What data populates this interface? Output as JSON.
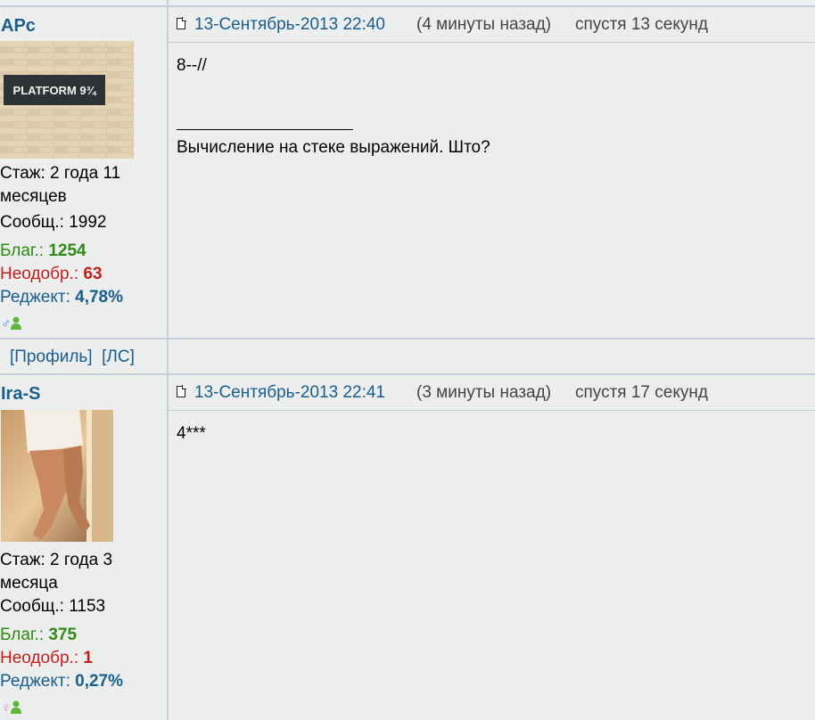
{
  "posts": [
    {
      "author": "APc",
      "avatar_text": "PLATFORM 9¾",
      "tenure": "Стаж: 2 года 11 месяцев",
      "messages_label": "Сообщ.:",
      "messages_value": "1992",
      "thanks_label": "Благ.:",
      "thanks_value": "1254",
      "disapprove_label": "Неодобр.:",
      "disapprove_value": "63",
      "reject_label": "Реджект:",
      "reject_value": "4,78%",
      "gender_icon": "male-icon",
      "date": "13-Сентябрь-2013 22:40",
      "ago": "(4 минуты назад)",
      "after": "спустя 13 секунд",
      "body_line1": "8--//",
      "signature": "Вычисление на стеке выражений. Што?",
      "profile_link": "[Профиль]",
      "pm_link": "[ЛС]"
    },
    {
      "author": "Ira-S",
      "tenure": "Стаж: 2 года 3 месяца",
      "messages_label": "Сообщ.:",
      "messages_value": "1153",
      "thanks_label": "Благ.:",
      "thanks_value": "375",
      "disapprove_label": "Неодобр.:",
      "disapprove_value": "1",
      "reject_label": "Реджект:",
      "reject_value": "0,27%",
      "gender_icon": "female-icon",
      "date": "13-Сентябрь-2013 22:41",
      "ago": "(3 минуты назад)",
      "after": "спустя 17 секунд",
      "body_line1": "4***"
    }
  ],
  "colors": {
    "link_blue": "#1a5e8c",
    "thanks_green": "#2e8a12",
    "disapprove_red": "#c21f1f",
    "border": "#c5cdd6",
    "background": "#eceded"
  }
}
